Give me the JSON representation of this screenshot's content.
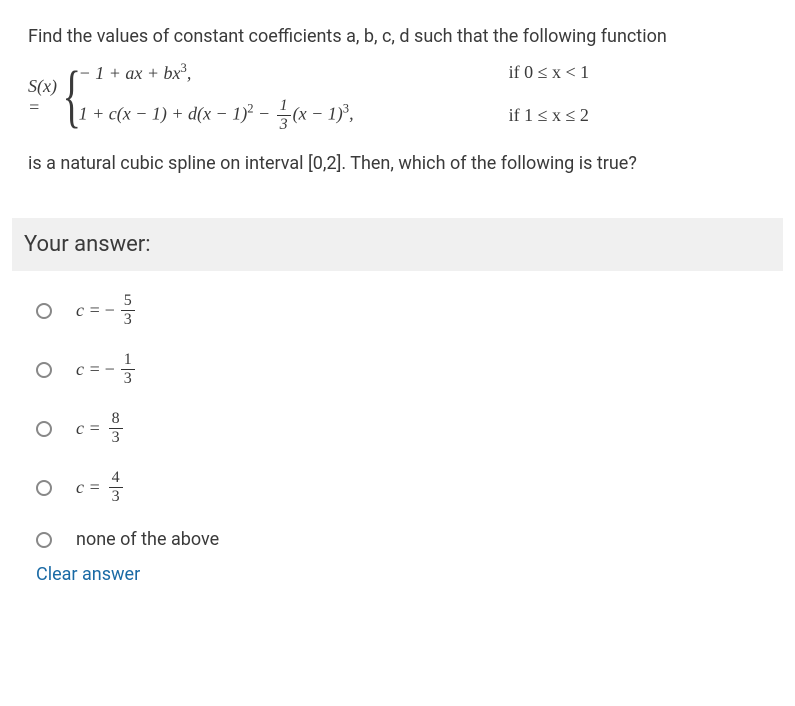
{
  "question": {
    "line1": "Find the values of constant coefficients a, b, c, d such that the following function",
    "sx": "S(x) =",
    "piece1_expr": "− 1 + ax + bx³,",
    "piece1_cond": "if  0 ≤ x < 1",
    "piece2_cond": "if  1 ≤ x ≤ 2",
    "line2": "is a natural cubic spline on interval [0,2]. Then, which of the following is true?"
  },
  "answer_header": "Your answer:",
  "options": [
    {
      "c_label": "c =",
      "neg": true,
      "num": "5",
      "den": "3"
    },
    {
      "c_label": "c =",
      "neg": true,
      "num": "1",
      "den": "3"
    },
    {
      "c_label": "c =",
      "neg": false,
      "num": "8",
      "den": "3"
    },
    {
      "c_label": "c =",
      "neg": false,
      "num": "4",
      "den": "3"
    }
  ],
  "none_option": "none of the above",
  "clear": "Clear answer"
}
